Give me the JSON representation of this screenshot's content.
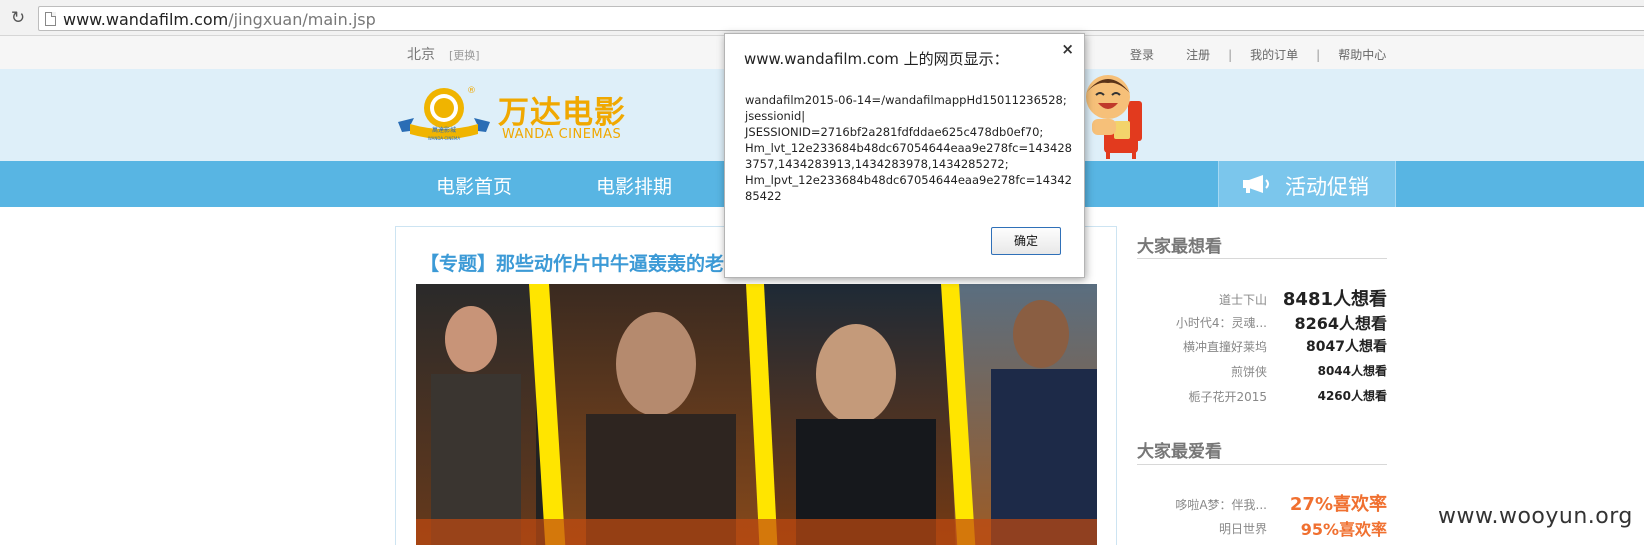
{
  "browser": {
    "url_host": "www.wandafilm.com",
    "url_path": "/jingxuan/main.jsp"
  },
  "topbar": {
    "city": "北京",
    "city_change": "[更换]",
    "links": [
      "登录",
      "注册",
      "我的订单",
      "帮助中心"
    ],
    "separator": "|"
  },
  "header": {
    "logo_cn": "万达电影",
    "logo_en": "WANDA CINEMAS",
    "emblem_text": "萬達影城",
    "emblem_sub": "WANDA CINEMA",
    "registered_mark": "®"
  },
  "nav": {
    "items": [
      "电影首页",
      "电影排期"
    ],
    "promo_label": "活动促销"
  },
  "content": {
    "title": "【专题】那些动作片中牛逼轰轰的老"
  },
  "sidebar": {
    "most_wanted": {
      "heading": "大家最想看",
      "rows": [
        {
          "name": "道士下山",
          "value": "8481人想看"
        },
        {
          "name": "小时代4：灵魂...",
          "value": "8264人想看"
        },
        {
          "name": "横冲直撞好莱坞",
          "value": "8047人想看"
        },
        {
          "name": "煎饼侠",
          "value": "8044人想看"
        },
        {
          "name": "栀子花开2015",
          "value": "4260人想看"
        }
      ]
    },
    "most_loved": {
      "heading": "大家最爱看",
      "rows": [
        {
          "name": "哆啦A梦：伴我...",
          "value": "27%喜欢率"
        },
        {
          "name": "明日世界",
          "value": "95%喜欢率"
        }
      ]
    }
  },
  "dialog": {
    "title": "www.wandafilm.com 上的网页显示：",
    "message_lines": [
      "wandafilm2015-06-14=/wandafilmappHd15011236528;",
      "jsessionid|",
      "JSESSIONID=2716bf2a281fdfddae625c478db0ef70;",
      "Hm_lvt_12e233684b48dc67054644eaa9e278fc=143428",
      "3757,1434283913,1434283978,1434285272;",
      "Hm_lpvt_12e233684b48dc67054644eaa9e278fc=14342",
      "85422"
    ],
    "close_glyph": "×",
    "ok_label": "确定"
  },
  "watermark": "www.wooyun.org",
  "colors": {
    "nav_blue": "#58b5e3",
    "header_bg": "#deeff9",
    "logo_gold": "#f0a800",
    "title_blue": "#3c9ad6",
    "loved_orange": "#f07030"
  }
}
